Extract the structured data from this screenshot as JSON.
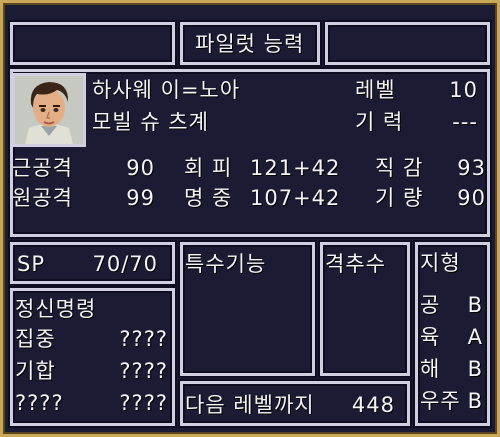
{
  "title": "파일럿 능력",
  "pilot": {
    "name": "하사웨 이=노아",
    "unit": "모빌 슈 츠계",
    "level_label": "레벨",
    "level": "10",
    "spirit_label": "기 력",
    "spirit": "---"
  },
  "stats": {
    "melee_label": "근공격",
    "melee": "90",
    "ranged_label": "원공격",
    "ranged": "99",
    "evade_label": "회 피",
    "evade": "121+42",
    "hit_label": "명 중",
    "hit": "107+42",
    "intuition_label": "직 감",
    "intuition": "93",
    "skill_label": "기 량",
    "skill": "90"
  },
  "sp": {
    "label": "SP",
    "value": "70/70"
  },
  "special_skills": {
    "label": "특수기능"
  },
  "kills": {
    "label": "격추수"
  },
  "terrain": {
    "label": "지형",
    "rows": [
      {
        "name": "공",
        "grade": "B"
      },
      {
        "name": "육",
        "grade": "A"
      },
      {
        "name": "해",
        "grade": "B"
      },
      {
        "name": "우주",
        "grade": "B"
      }
    ]
  },
  "spirit_commands": {
    "label": "정신명령",
    "rows": [
      {
        "name": "집중",
        "value": "????"
      },
      {
        "name": "기합",
        "value": "????"
      },
      {
        "name": "????",
        "value": "????"
      }
    ]
  },
  "next_level": {
    "label": "다음 레벨까지",
    "value": "448"
  },
  "colors": {
    "panel_bg": "#1b1b34",
    "border": "#cfcfe0",
    "frame": "#c9a85a",
    "text": "#f4f4f4"
  }
}
